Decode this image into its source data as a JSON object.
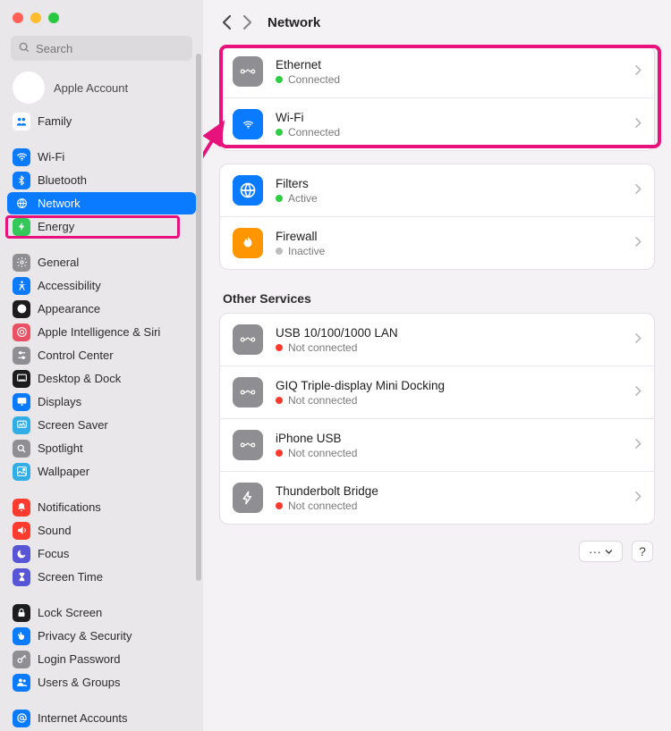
{
  "window": {
    "search_placeholder": "Search"
  },
  "account": {
    "label": "Apple Account"
  },
  "sidebar": {
    "items": [
      {
        "label": "Family",
        "icon": "family-icon",
        "bg": "#ffffff",
        "fg": "#0a7aff"
      },
      {
        "gap": true
      },
      {
        "label": "Wi-Fi",
        "icon": "wifi-icon",
        "bg": "#0a7aff"
      },
      {
        "label": "Bluetooth",
        "icon": "bluetooth-icon",
        "bg": "#0a7aff"
      },
      {
        "label": "Network",
        "icon": "globe-icon",
        "bg": "#0a7aff",
        "selected": true
      },
      {
        "label": "Energy",
        "icon": "bolt-icon",
        "bg": "#34c759"
      },
      {
        "gap": true
      },
      {
        "label": "General",
        "icon": "gear-icon",
        "bg": "#8e8e93"
      },
      {
        "label": "Accessibility",
        "icon": "accessibility-icon",
        "bg": "#0a7aff"
      },
      {
        "label": "Appearance",
        "icon": "appearance-icon",
        "bg": "#1c1c1e"
      },
      {
        "label": "Apple Intelligence & Siri",
        "icon": "siri-icon",
        "bg": "#ea5165"
      },
      {
        "label": "Control Center",
        "icon": "control-center-icon",
        "bg": "#8e8e93"
      },
      {
        "label": "Desktop & Dock",
        "icon": "dock-icon",
        "bg": "#1c1c1e"
      },
      {
        "label": "Displays",
        "icon": "display-icon",
        "bg": "#0a7aff"
      },
      {
        "label": "Screen Saver",
        "icon": "screensaver-icon",
        "bg": "#32ade6"
      },
      {
        "label": "Spotlight",
        "icon": "search-icon",
        "bg": "#8e8e93"
      },
      {
        "label": "Wallpaper",
        "icon": "wallpaper-icon",
        "bg": "#32ade6"
      },
      {
        "gap": true
      },
      {
        "label": "Notifications",
        "icon": "bell-icon",
        "bg": "#ff3b30"
      },
      {
        "label": "Sound",
        "icon": "speaker-icon",
        "bg": "#ff3b30"
      },
      {
        "label": "Focus",
        "icon": "moon-icon",
        "bg": "#5856d6"
      },
      {
        "label": "Screen Time",
        "icon": "hourglass-icon",
        "bg": "#5856d6"
      },
      {
        "gap": true
      },
      {
        "label": "Lock Screen",
        "icon": "lock-icon",
        "bg": "#1c1c1e"
      },
      {
        "label": "Privacy & Security",
        "icon": "hand-icon",
        "bg": "#0a7aff"
      },
      {
        "label": "Login Password",
        "icon": "key-icon",
        "bg": "#8e8e93"
      },
      {
        "label": "Users & Groups",
        "icon": "users-icon",
        "bg": "#0a7aff"
      },
      {
        "gap": true
      },
      {
        "label": "Internet Accounts",
        "icon": "at-icon",
        "bg": "#0a7aff"
      }
    ]
  },
  "header": {
    "title": "Network",
    "back_enabled": true,
    "forward_enabled": false
  },
  "network": {
    "primary": [
      {
        "title": "Ethernet",
        "status": "Connected",
        "status_color": "st-green",
        "icon": "ethernet-icon",
        "bg": "#8e8e93"
      },
      {
        "title": "Wi-Fi",
        "status": "Connected",
        "status_color": "st-green",
        "icon": "wifi-icon",
        "bg": "#0a7aff"
      }
    ],
    "secondary": [
      {
        "title": "Filters",
        "status": "Active",
        "status_color": "st-green",
        "icon": "filters-icon",
        "bg": "#0a7aff"
      },
      {
        "title": "Firewall",
        "status": "Inactive",
        "status_color": "st-gray",
        "icon": "firewall-icon",
        "bg": "#ff9500"
      }
    ],
    "other_header": "Other Services",
    "other": [
      {
        "title": "USB 10/100/1000 LAN",
        "status": "Not connected",
        "status_color": "st-red",
        "icon": "ethernet-icon",
        "bg": "#8e8e93"
      },
      {
        "title": "GIQ Triple-display Mini Docking",
        "status": "Not connected",
        "status_color": "st-red",
        "icon": "ethernet-icon",
        "bg": "#8e8e93"
      },
      {
        "title": "iPhone USB",
        "status": "Not connected",
        "status_color": "st-red",
        "icon": "ethernet-icon",
        "bg": "#8e8e93"
      },
      {
        "title": "Thunderbolt Bridge",
        "status": "Not connected",
        "status_color": "st-red",
        "icon": "thunderbolt-icon",
        "bg": "#8e8e93"
      }
    ]
  },
  "footer": {
    "more_label": "···",
    "help_label": "?"
  },
  "annotations": {
    "highlight_primary": true,
    "highlight_sidebar_network": true,
    "arrow": true
  }
}
